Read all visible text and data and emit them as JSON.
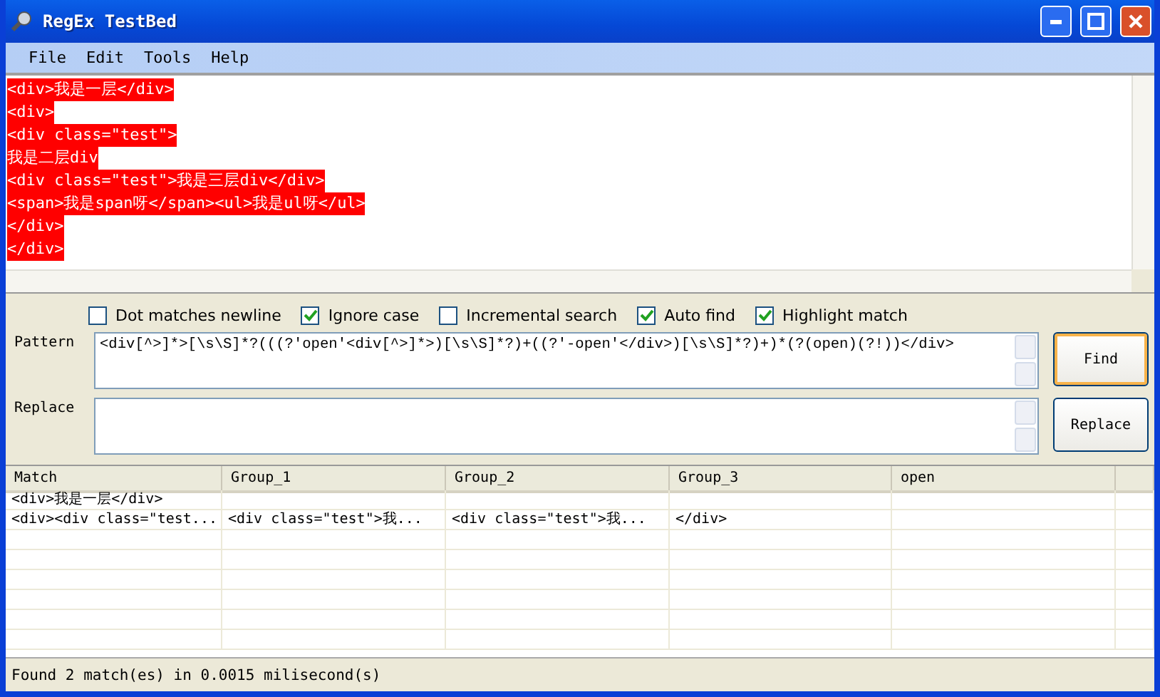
{
  "window": {
    "title": "RegEx TestBed"
  },
  "menu": [
    {
      "label": "File"
    },
    {
      "label": "Edit"
    },
    {
      "label": "Tools"
    },
    {
      "label": "Help"
    }
  ],
  "editor": {
    "lines": [
      {
        "text": "<div>我是一层</div>",
        "highlighted": true
      },
      {
        "text": "<div>",
        "highlighted": true
      },
      {
        "text": "<div class=\"test\">",
        "highlighted": true
      },
      {
        "text": "我是二层div",
        "highlighted": true
      },
      {
        "text": "<div class=\"test\">我是三层div</div>",
        "highlighted": true
      },
      {
        "text": "<span>我是span呀</span><ul>我是ul呀</ul>",
        "highlighted": true
      },
      {
        "text": "</div>",
        "highlighted": true
      },
      {
        "text": "</div>",
        "highlighted": true
      }
    ]
  },
  "options": [
    {
      "label": "Dot matches newline",
      "checked": false
    },
    {
      "label": "Ignore case",
      "checked": true
    },
    {
      "label": "Incremental search",
      "checked": false
    },
    {
      "label": "Auto find",
      "checked": true
    },
    {
      "label": "Highlight match",
      "checked": true
    }
  ],
  "pattern": {
    "label": "Pattern",
    "value": "<div[^>]*>[\\s\\S]*?(((?'open'<div[^>]*>)[\\s\\S]*?)+((?'-open'</div>)[\\s\\S]*?)+)*(?(open)(?!))</div>"
  },
  "replace": {
    "label": "Replace"
  },
  "buttons": [
    {
      "label": "Find",
      "focused": true
    },
    {
      "label": "Replace",
      "focused": false
    }
  ],
  "table": {
    "columns": [
      "Match",
      "Group_1",
      "Group_2",
      "Group_3",
      "open"
    ],
    "rows": [
      [
        "<div>我是一层</div>",
        "",
        "",
        "",
        ""
      ],
      [
        "<div><div class=\"test...",
        "<div class=\"test\">我...",
        "<div class=\"test\">我...",
        "</div>",
        ""
      ]
    ]
  },
  "status_bar": "Found 2 match(es) in 0.0015 milisecond(s)"
}
